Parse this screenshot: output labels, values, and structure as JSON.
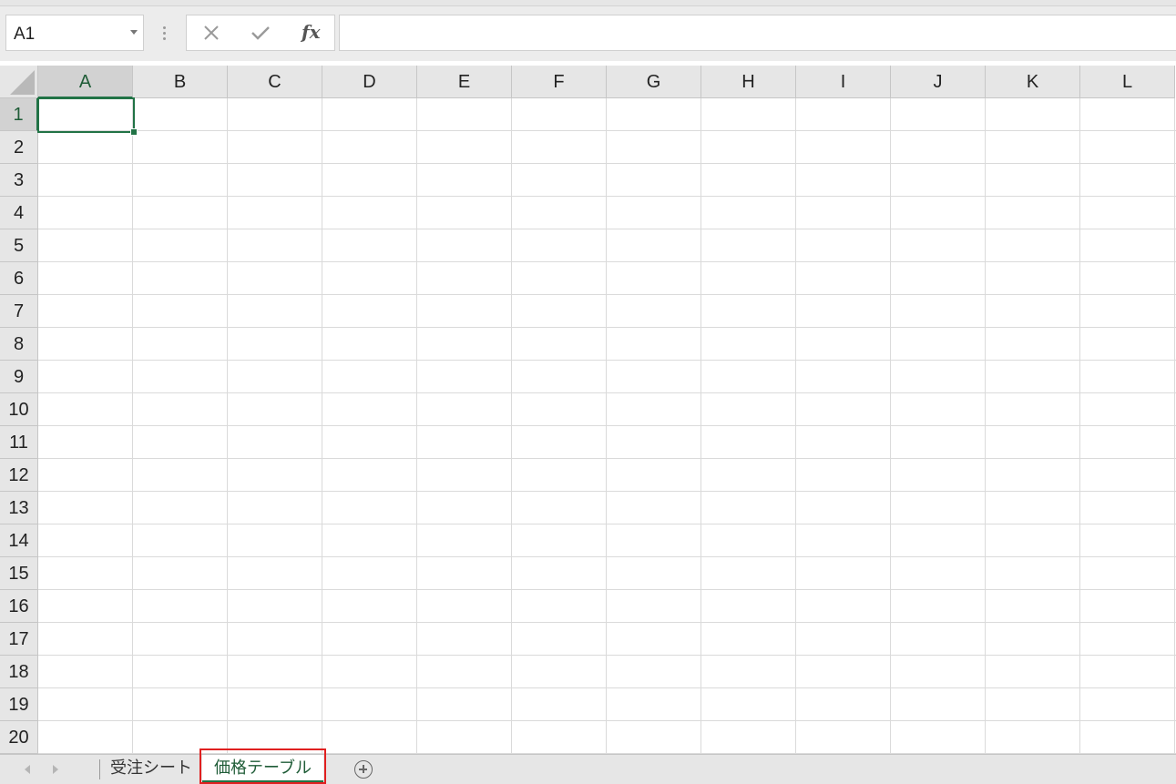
{
  "formula_bar": {
    "name_box_value": "A1",
    "cancel_icon": "close-icon",
    "enter_icon": "check-icon",
    "function_label": "fx",
    "formula_value": ""
  },
  "columns": [
    "A",
    "B",
    "C",
    "D",
    "E",
    "F",
    "G",
    "H",
    "I",
    "J",
    "K",
    "L"
  ],
  "rows": [
    "1",
    "2",
    "3",
    "4",
    "5",
    "6",
    "7",
    "8",
    "9",
    "10",
    "11",
    "12",
    "13",
    "14",
    "15",
    "16",
    "17",
    "18",
    "19",
    "20"
  ],
  "active_cell": "A1",
  "sheet_tabs": [
    {
      "label": "受注シート",
      "active": false
    },
    {
      "label": "価格テーブル",
      "active": true
    }
  ],
  "colors": {
    "accent": "#217346",
    "highlight_frame": "#e02020",
    "header_bg": "#e6e6e6",
    "gridline": "#dadada"
  }
}
